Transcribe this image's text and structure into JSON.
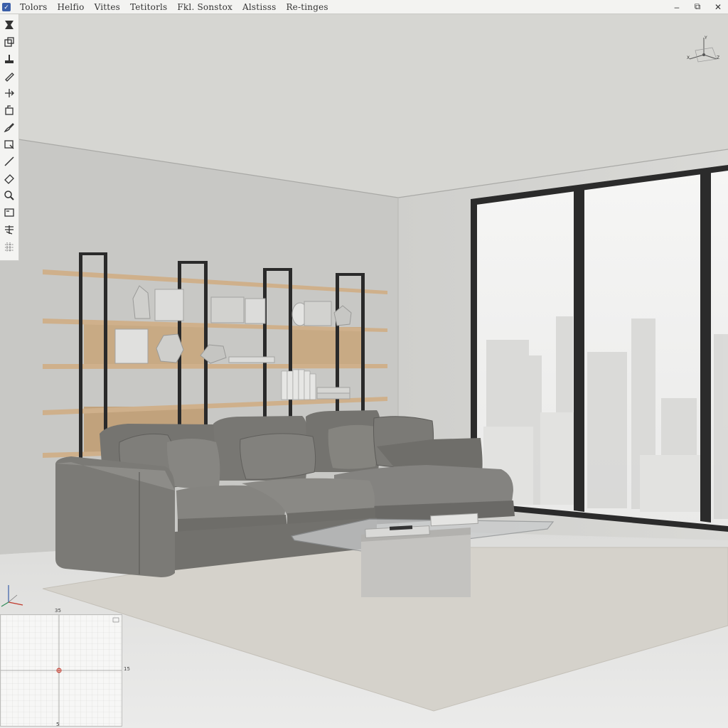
{
  "menu": {
    "items": [
      "Tolors",
      "Helfio",
      "Vittes",
      "Tetitorls",
      "Fkl. Sonstox",
      "Alstisss",
      "Re-tinges"
    ]
  },
  "window_controls": {
    "minimize": "–",
    "maximize": "⧉",
    "close": "✕"
  },
  "toolbar": {
    "tools": [
      "select-icon",
      "box-icon",
      "paint-icon",
      "pencil-icon",
      "move-icon",
      "rotate-icon",
      "brush-icon",
      "rectangle-icon",
      "line-icon",
      "eraser-icon",
      "zoom-icon",
      "frame-icon",
      "snap-icon",
      "grid-icon"
    ]
  },
  "minimap": {
    "top_label": "35",
    "right_label": "15",
    "bottom_label": "5"
  },
  "colors": {
    "wall_left": "#c9c9c6",
    "wall_right": "#d3d3d0",
    "ceiling": "#d6d6d2",
    "floor": "#e3e3e1",
    "sofa": "#7d7c78",
    "shelf_wood": "#c9ab85",
    "frame": "#2b2b2b",
    "accent": "#3a5ea8"
  }
}
